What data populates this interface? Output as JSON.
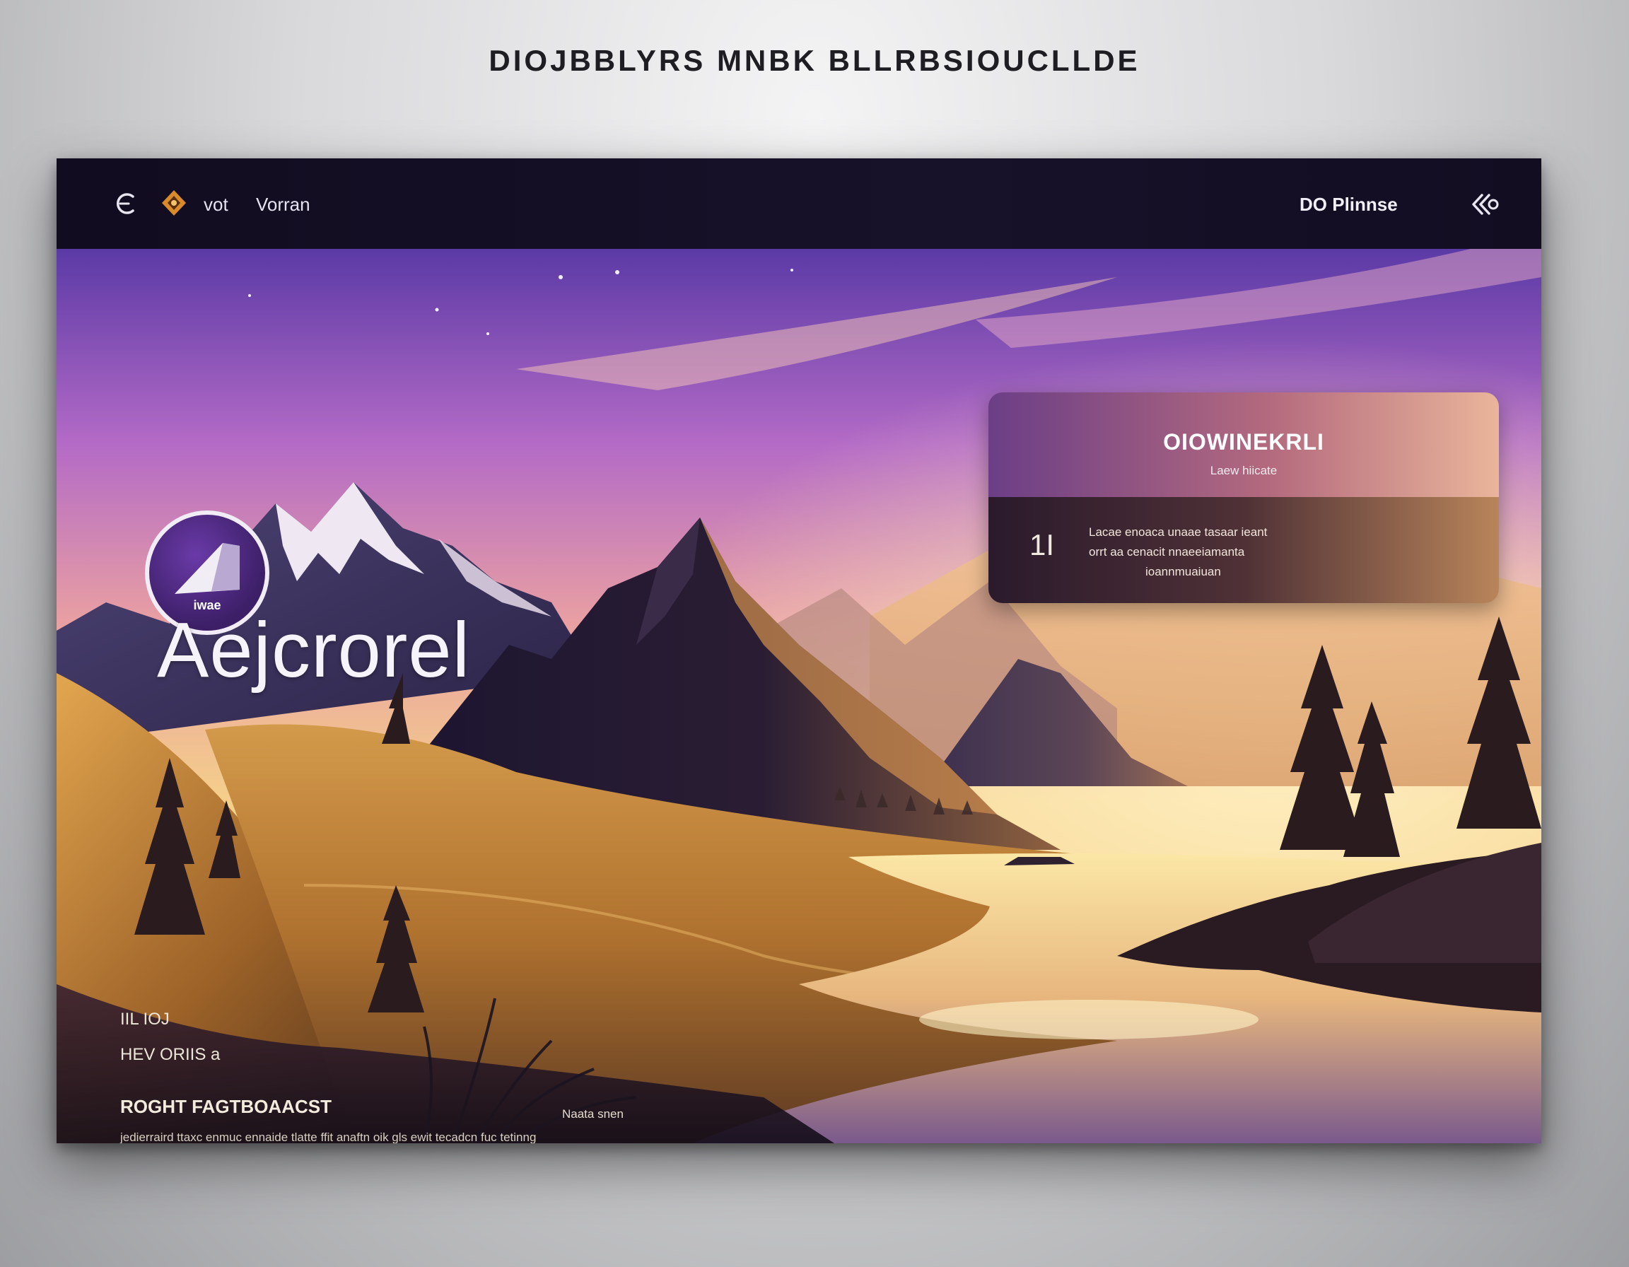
{
  "caption": "DIOJBBLYRS MNBK BLLRBSIOUCLLDE",
  "nav": {
    "link_1": "vot",
    "link_2": "Vorran",
    "cta": "DO Plinnse"
  },
  "hero": {
    "emblem_label": "iwae",
    "title": "Aejcrorel",
    "meta_small": "IIL IOJ",
    "meta_label": "HEV ORIIS a",
    "meta_heading": "ROGHT FAGTBOAACST",
    "meta_body": "jedierraird ttaxc enmuc ennaide tlatte ffit anaftn oik gls ewit tecadcn fuc tetinng",
    "meta_author": "Naata snen"
  },
  "card": {
    "title": "OIOWINEKRLI",
    "subtitle": "Laew hiicate",
    "number": "1I",
    "line_1": "Lacae enoaca unaae tasaar ieant",
    "line_2": "orrt aa cenacit nnaeeiamanta",
    "line_3": "ioannmuaiuan"
  },
  "panel": {
    "input_value": "",
    "input_placeholder": "",
    "mark": "■"
  },
  "icons": {
    "back": "back-icon",
    "logo": "logo-icon",
    "share": "share-icon",
    "round_button": "emblem-badge-icon"
  },
  "colors": {
    "nav_bg": "#140f24",
    "sky_top": "#5b3aa6",
    "sky_mid": "#e9a0a2",
    "sky_horizon": "#f5d08a",
    "accent_purple": "#6a3aa8"
  }
}
